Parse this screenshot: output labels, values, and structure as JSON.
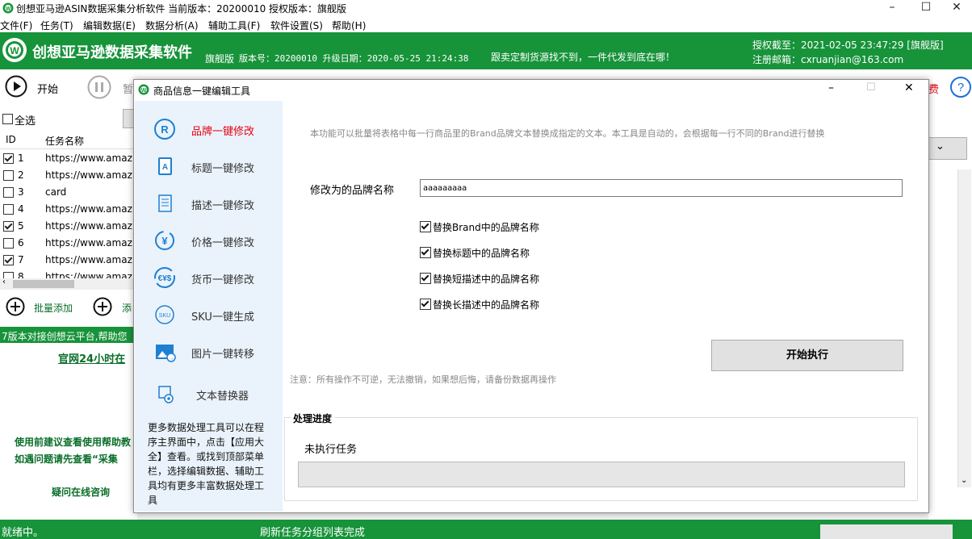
{
  "window": {
    "title": "创想亚马逊ASIN数据采集分析软件   当前版本：20200010  授权版本：旗舰版"
  },
  "menu": [
    "文件(F)",
    "任务(T)",
    "编辑数据(E)",
    "数据分析(A)",
    "辅助工具(F)",
    "软件设置(S)",
    "帮助(H)"
  ],
  "banner": {
    "logo_text": "创想亚马逊数据采集软件",
    "edition": "旗舰版",
    "version_info": "版本号：20200010  升级日期：2020-05-25 21:24:38",
    "slogan": "跟卖定制货源找不到，一件代发到底在哪！",
    "auth_expire": "授权截至：2021-02-05 23:47:29 [旗舰版]",
    "reg_email": "注册邮箱：cxruanjian@163.com"
  },
  "toolbar": {
    "start": "开始",
    "pause": "暂",
    "partial_right": "费"
  },
  "left": {
    "select_all": "全选",
    "col_id": "ID",
    "col_name": "任务名称",
    "rows": [
      {
        "id": "1",
        "name": "https://www.amaz...",
        "checked": true
      },
      {
        "id": "2",
        "name": "https://www.amaz...",
        "checked": false
      },
      {
        "id": "3",
        "name": "card",
        "checked": false
      },
      {
        "id": "4",
        "name": "https://www.amaz...",
        "checked": false
      },
      {
        "id": "5",
        "name": "https://www.amaz...",
        "checked": true
      },
      {
        "id": "6",
        "name": "https://www.amaz...",
        "checked": false
      },
      {
        "id": "7",
        "name": "https://www.amaz...",
        "checked": true
      },
      {
        "id": "8",
        "name": "https://www.amaz...",
        "checked": false
      }
    ],
    "batch_add": "批量添加",
    "add": "添",
    "notice": "7版本对接创想云平台,帮助您",
    "online": "官网24小时在",
    "help1": "使用前建议查看使用帮助教",
    "help2": "如遇问题请先查看“采集",
    "consult": "疑问在线咨询"
  },
  "statusbar": {
    "left": "就绪中。",
    "center": "刷新任务分组列表完成"
  },
  "dialog": {
    "title": "商品信息一键编辑工具",
    "side_items": [
      {
        "label": "品牌一键修改",
        "icon": "brand-r-icon",
        "active": true
      },
      {
        "label": "标题一键修改",
        "icon": "title-book-icon",
        "active": false
      },
      {
        "label": "描述一键修改",
        "icon": "description-doc-icon",
        "active": false
      },
      {
        "label": "价格一键修改",
        "icon": "price-yen-icon",
        "active": false
      },
      {
        "label": "货币一键修改",
        "icon": "currency-exchange-icon",
        "active": false
      },
      {
        "label": "SKU一键生成",
        "icon": "sku-icon",
        "active": false
      },
      {
        "label": "图片一键转移",
        "icon": "image-transfer-icon",
        "active": false
      },
      {
        "label": "文本替换器",
        "icon": "text-replace-icon",
        "active": false
      }
    ],
    "side_note": "更多数据处理工具可以在程序主界面中，点击【应用大全】查看。或找到顶部菜单栏，选择编辑数据、辅助工具均有更多丰富数据处理工具",
    "description": "本功能可以批量将表格中每一行商品里的Brand品牌文本替换成指定的文本。本工具是自动的，会根据每一行不同的Brand进行替换",
    "brand_label": "修改为的品牌名称",
    "brand_value": "aaaaaaaaa",
    "options": [
      {
        "label": "替换Brand中的品牌名称",
        "checked": true
      },
      {
        "label": "替换标题中的品牌名称",
        "checked": true
      },
      {
        "label": "替换短描述中的品牌名称",
        "checked": true
      },
      {
        "label": "替换长描述中的品牌名称",
        "checked": true
      }
    ],
    "execute_button": "开始执行",
    "warning": "注意：所有操作不可逆，无法撤销，如果想后悔，请备份数据再操作",
    "progress_group": "处理进度",
    "progress_status": "未执行任务",
    "progress_value": 0
  },
  "colors": {
    "brand_green": "#17933a",
    "active_red": "#e60012",
    "side_bg": "#eaf3fb"
  }
}
